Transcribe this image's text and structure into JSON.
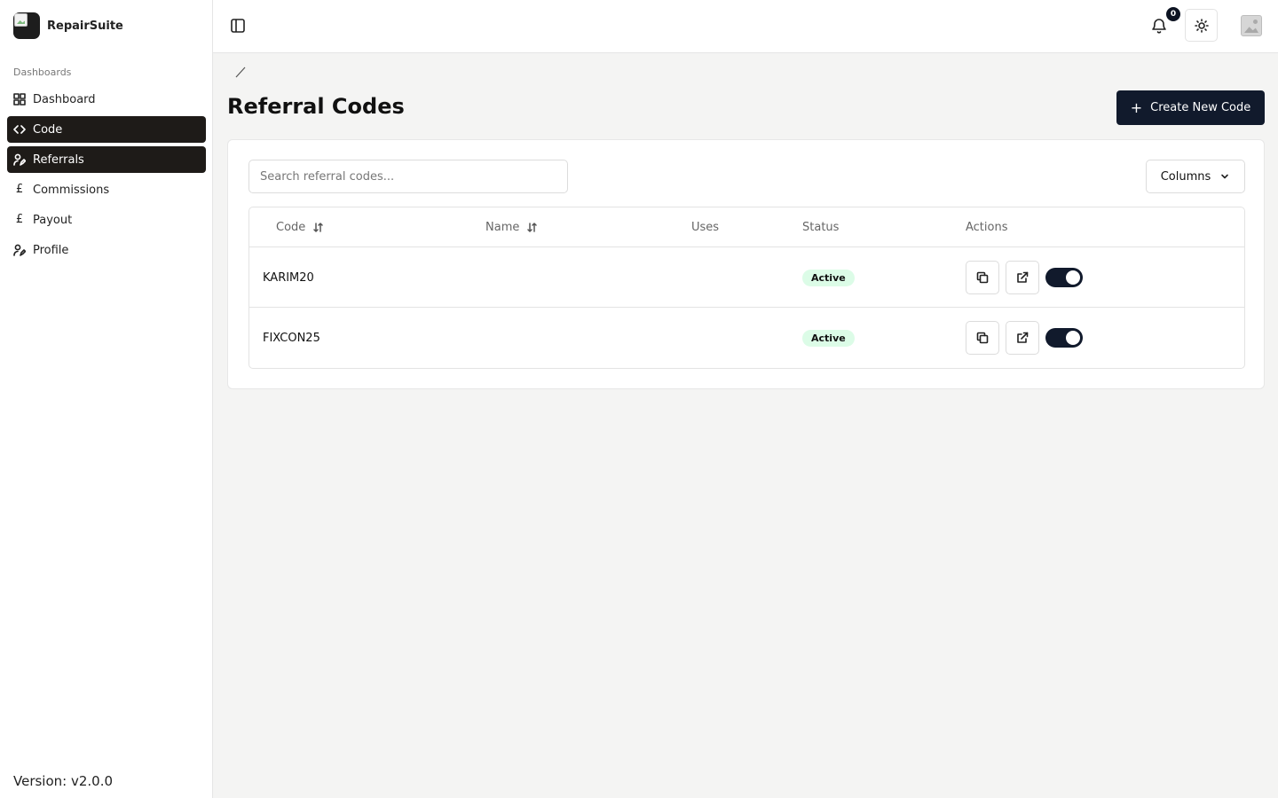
{
  "brand": {
    "name": "RepairSuite"
  },
  "sidebar": {
    "section_label": "Dashboards",
    "items": [
      {
        "label": "Dashboard",
        "icon": "dashboard-grid-icon",
        "active": false
      },
      {
        "label": "Code",
        "icon": "code-icon",
        "active": true
      },
      {
        "label": "Referrals",
        "icon": "user-pen-icon",
        "active": true
      },
      {
        "label": "Commissions",
        "icon": "pound-icon",
        "active": false
      },
      {
        "label": "Payout",
        "icon": "pound-icon",
        "active": false
      },
      {
        "label": "Profile",
        "icon": "user-pen-icon",
        "active": false
      }
    ],
    "version": "Version: v2.0.0"
  },
  "topbar": {
    "notification_count": "0",
    "icons": [
      "panel-left-icon",
      "bell-icon",
      "sun-icon",
      "avatar-image-icon"
    ]
  },
  "main": {
    "breadcrumb_separator": "/",
    "title": "Referral Codes",
    "create_button_label": "Create New Code",
    "search_placeholder": "Search referral codes...",
    "columns_button_label": "Columns",
    "table": {
      "headers": [
        "Code",
        "Name",
        "Uses",
        "Status",
        "Actions"
      ],
      "rows": [
        {
          "code": "KARIM20",
          "name": "",
          "uses": "",
          "status": "Active",
          "enabled": true
        },
        {
          "code": "FIXCON25",
          "name": "",
          "uses": "",
          "status": "Active",
          "enabled": true
        }
      ]
    }
  },
  "colors": {
    "primary": "#111a2c",
    "sidebar_active": "#1e1b18",
    "status_active_bg": "#dcfce7",
    "page_bg": "#f4f4f3"
  }
}
